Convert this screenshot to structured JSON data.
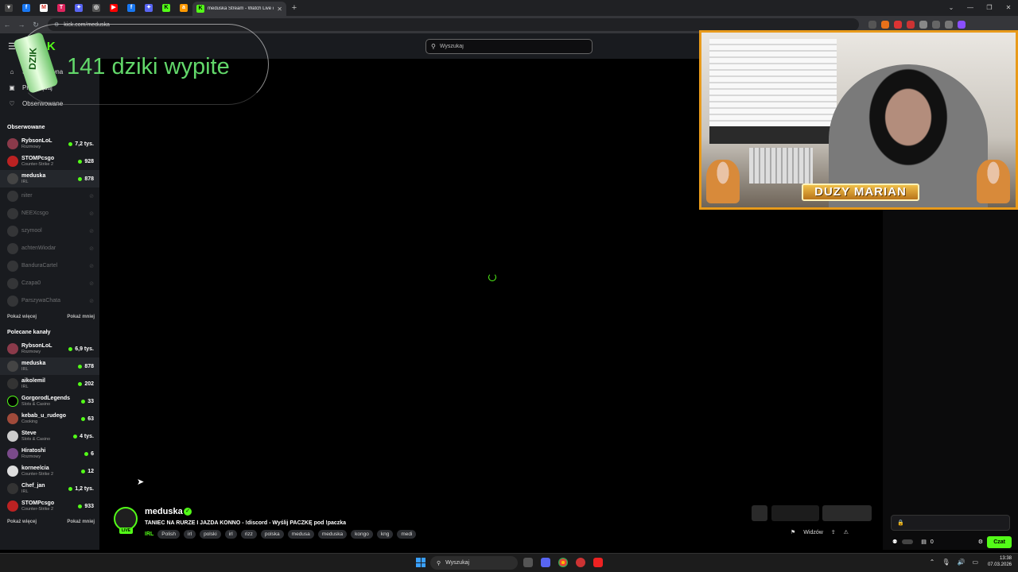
{
  "browser": {
    "active_tab_title": "meduska Stream - Watch Live o",
    "url": "kick.com/meduska",
    "new_tab": "+",
    "tab_close": "✕"
  },
  "kick": {
    "logo": "KICK",
    "search_placeholder": "Wyszukaj"
  },
  "overlay": {
    "can_label": "DZIK",
    "counter_text": "141 dziki wypite"
  },
  "sidebar": {
    "nav": [
      {
        "label": "Strona główna",
        "icon": "home-icon"
      },
      {
        "label": "Przeglądaj",
        "icon": "browse-icon"
      },
      {
        "label": "Obserwowane",
        "icon": "heart-icon"
      }
    ],
    "followed_title": "Obserwowane",
    "followed": [
      {
        "name": "RybsonLoL",
        "category": "Rozmowy",
        "viewers": "7,2 tys.",
        "live": true
      },
      {
        "name": "STOMPcsgo",
        "category": "Counter-Strike 2",
        "viewers": "928",
        "live": true
      },
      {
        "name": "meduska",
        "category": "IRL",
        "viewers": "878",
        "live": true
      },
      {
        "name": "niter",
        "live": false
      },
      {
        "name": "NEEXcsgo",
        "live": false
      },
      {
        "name": "szymool",
        "live": false
      },
      {
        "name": "achtenWiodar",
        "live": false
      },
      {
        "name": "BanduraCartel",
        "live": false
      },
      {
        "name": "Czapa0",
        "live": false
      },
      {
        "name": "ParszywaChata",
        "live": false
      }
    ],
    "show_more": "Pokaż więcej",
    "show_less": "Pokaż mniej",
    "recommended_title": "Polecane kanały",
    "recommended": [
      {
        "name": "RybsonLoL",
        "category": "Rozmowy",
        "viewers": "6,9 tys."
      },
      {
        "name": "meduska",
        "category": "IRL",
        "viewers": "878"
      },
      {
        "name": "aikolemil",
        "category": "IRL",
        "viewers": "202"
      },
      {
        "name": "GorgorodLegends",
        "category": "Slots & Casino",
        "viewers": "33"
      },
      {
        "name": "kebab_u_rudego",
        "category": "Cooking",
        "viewers": "63"
      },
      {
        "name": "Steve",
        "category": "Slots & Casino",
        "viewers": "4 tys."
      },
      {
        "name": "Hiratoshi",
        "category": "Rozmowy",
        "viewers": "6"
      },
      {
        "name": "korneelcia",
        "category": "Counter-Strike 2",
        "viewers": "12"
      },
      {
        "name": "Chef_jan",
        "category": "IRL",
        "viewers": "1,2 tys."
      },
      {
        "name": "STOMPcsgo",
        "category": "Counter-Strike 2",
        "viewers": "933"
      }
    ]
  },
  "webcam": {
    "name_plate": "DUZY MARIAN"
  },
  "stream": {
    "live_badge": "LIVE",
    "streamer": "meduska",
    "title": "TANIEC NA RURZE I JAZDA KONNO - !discord - Wyślij PACZKĘ pod !paczka",
    "category": "IRL",
    "tags": [
      "Polish",
      "irl",
      "polski",
      "irl",
      "rizz",
      "polska",
      "medusa",
      "meduska",
      "kongo",
      "kng",
      "medi"
    ],
    "viewers_label": "Widzów"
  },
  "chat": {
    "count": "0",
    "send_label": "Czat"
  },
  "taskbar": {
    "search_label": "Wyszukaj",
    "time": "13:38",
    "date": "07.03.2026"
  },
  "colors": {
    "kick_green": "#53fc18",
    "webcam_border": "#e89a1a"
  }
}
